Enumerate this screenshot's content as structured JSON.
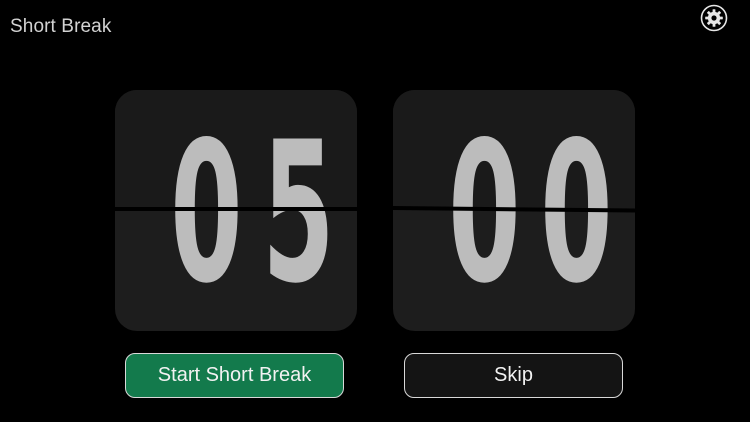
{
  "header": {
    "title": "Short Break",
    "settings_icon": "gear-icon"
  },
  "timer": {
    "minutes": "05",
    "seconds": "00",
    "minutes_digits": [
      "0",
      "5"
    ],
    "seconds_digits": [
      "0",
      "0"
    ]
  },
  "actions": {
    "start_label": "Start Short Break",
    "skip_label": "Skip"
  },
  "colors": {
    "background": "#000000",
    "card": "#1d1d1d",
    "digit": "#bcbcbc",
    "start_button": "#137a4c",
    "skip_button": "#141414",
    "button_border": "#d9d9d9"
  }
}
